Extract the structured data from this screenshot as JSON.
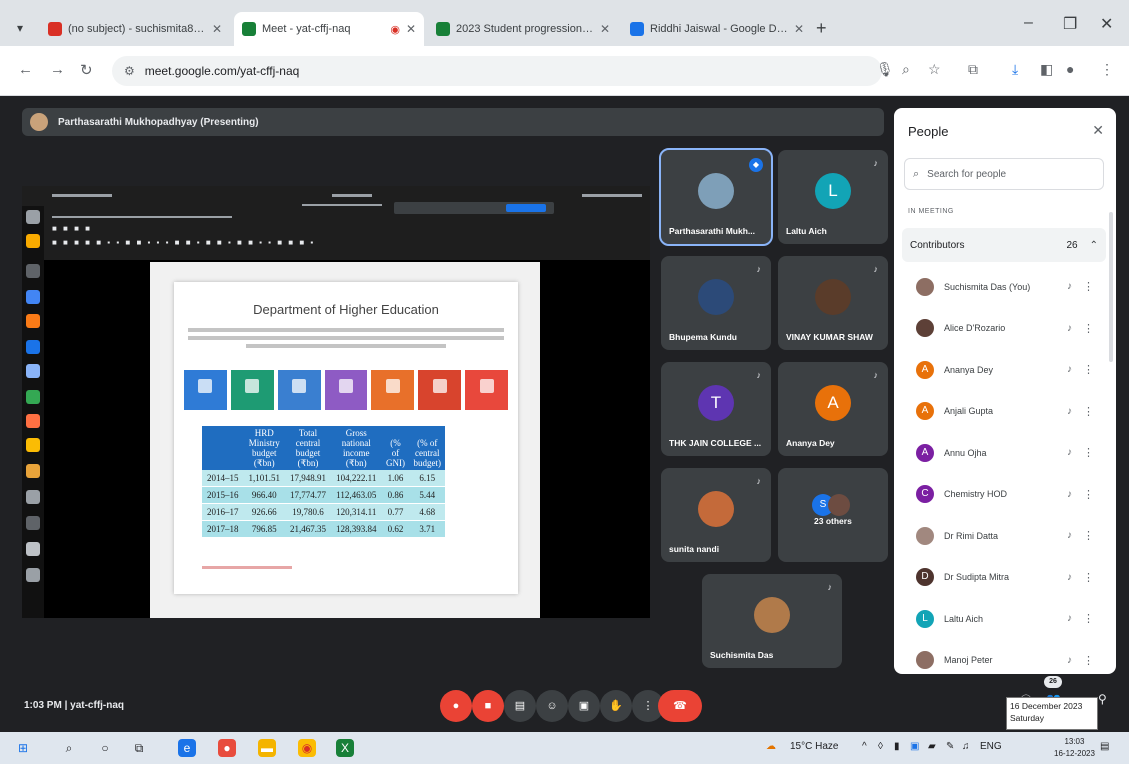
{
  "browser": {
    "tabs": [
      {
        "title": "(no subject) - suchismita87@...",
        "favicon_color": "#d93025",
        "active": false
      },
      {
        "title": "Meet - yat-cffj-naq",
        "favicon_color": "#188038",
        "active": true
      },
      {
        "title": "2023 Student progression dat...",
        "favicon_color": "#188038",
        "active": false
      },
      {
        "title": "Riddhi Jaiswal - Google Docs",
        "favicon_color": "#1a73e8",
        "active": false
      }
    ],
    "url": "meet.google.com/yat-cffj-naq"
  },
  "meet": {
    "presenter_label": "Parthasarathi Mukhopadhyay (Presenting)",
    "meeting_info": "1:03 PM  |  yat-cffj-naq",
    "participant_count": "26",
    "slide": {
      "title": "Department of Higher Education",
      "table_headers": [
        "",
        "HRD Ministry budget (₹bn)",
        "Total central budget (₹bn)",
        "Gross national income (₹bn)",
        "(% of GNI)",
        "(% of central budget)"
      ],
      "table_rows": [
        [
          "2014–15",
          "1,101.51",
          "17,948.91",
          "104,222.11",
          "1.06",
          "6.15"
        ],
        [
          "2015–16",
          "966.40",
          "17,774.77",
          "112,463.05",
          "0.86",
          "5.44"
        ],
        [
          "2016–17",
          "926.66",
          "19,780.6",
          "120,314.11",
          "0.77",
          "4.68"
        ],
        [
          "2017–18",
          "796.85",
          "21,467.35",
          "128,393.84",
          "0.62",
          "3.71"
        ]
      ],
      "tile_colors": [
        "#2f7bd6",
        "#1e9b73",
        "#3a7fd0",
        "#8e5bc4",
        "#e8702a",
        "#d8442d",
        "#e8483c"
      ]
    },
    "participants": [
      {
        "name": "Parthasarathi Mukh...",
        "initial": "",
        "color": "#7e9fb8",
        "speaking": true
      },
      {
        "name": "Laltu Aich",
        "initial": "L",
        "color": "#12a4b6"
      },
      {
        "name": "Bhupema Kundu",
        "initial": "",
        "color": "#2c4a78"
      },
      {
        "name": "VINAY KUMAR SHAW",
        "initial": "",
        "color": "#5a3c2a"
      },
      {
        "name": "THK JAIN COLLEGE ...",
        "initial": "T",
        "color": "#5e35b1"
      },
      {
        "name": "Ananya Dey",
        "initial": "A",
        "color": "#e8710a"
      },
      {
        "name": "sunita nandi",
        "initial": "",
        "color": "#c46a3a"
      },
      {
        "name": "23 others",
        "initial": "S",
        "color": "#1a73e8"
      },
      {
        "name": "Suchismita Das",
        "initial": "",
        "color": "#b07a4a"
      }
    ],
    "controls": [
      {
        "name": "mic-button",
        "icon": "●",
        "color": "red"
      },
      {
        "name": "camera-button",
        "icon": "■",
        "color": "red"
      },
      {
        "name": "captions-button",
        "icon": "▤",
        "color": "grey"
      },
      {
        "name": "emoji-button",
        "icon": "☺",
        "color": "grey"
      },
      {
        "name": "present-button",
        "icon": "▣",
        "color": "grey"
      },
      {
        "name": "raise-hand-button",
        "icon": "✋",
        "color": "grey"
      },
      {
        "name": "more-options-button",
        "icon": "⋮",
        "color": "grey"
      }
    ]
  },
  "people_panel": {
    "title": "People",
    "search_placeholder": "Search for people",
    "section": "IN MEETING",
    "contributors_label": "Contributors",
    "contributors_count": "26",
    "people": [
      {
        "name": "Suchismita Das (You)",
        "initial": "",
        "color": "#8d6e63"
      },
      {
        "name": "Alice D'Rozario",
        "initial": "",
        "color": "#5d4037"
      },
      {
        "name": "Ananya Dey",
        "initial": "A",
        "color": "#e8710a"
      },
      {
        "name": "Anjali Gupta",
        "initial": "A",
        "color": "#e8710a"
      },
      {
        "name": "Annu Ojha",
        "initial": "A",
        "color": "#7b1fa2"
      },
      {
        "name": "Chemistry HOD",
        "initial": "C",
        "color": "#7b1fa2"
      },
      {
        "name": "Dr Rimi Datta",
        "initial": "",
        "color": "#a1887f"
      },
      {
        "name": "Dr Sudipta Mitra",
        "initial": "D",
        "color": "#4e342e"
      },
      {
        "name": "Laltu Aich",
        "initial": "L",
        "color": "#12a4b6"
      },
      {
        "name": "Manoj Peter",
        "initial": "",
        "color": "#8d6e63"
      }
    ]
  },
  "taskbar": {
    "weather": "15°C Haze",
    "language": "ENG",
    "time": "13:03",
    "date": "16-12-2023",
    "tooltip_line1": "16 December 2023",
    "tooltip_line2": "Saturday"
  }
}
